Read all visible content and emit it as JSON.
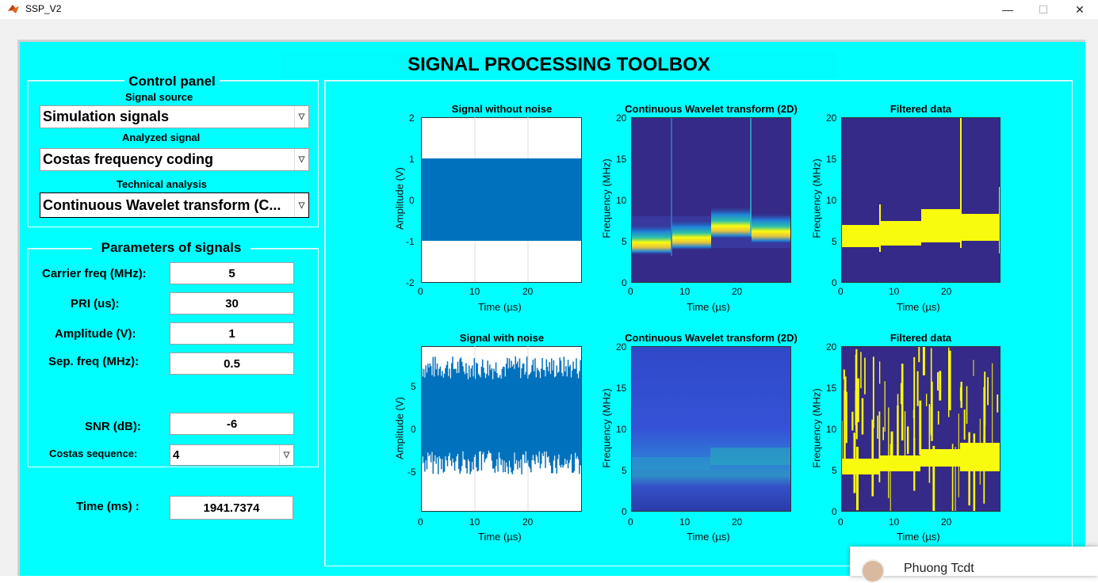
{
  "window": {
    "title": "SSP_V2",
    "min": "—",
    "max": "☐",
    "close": "✕"
  },
  "main_title": "SIGNAL PROCESSING TOOLBOX",
  "control_panel": {
    "title": "Control panel",
    "signal_source_label": "Signal source",
    "signal_source_value": "Simulation signals",
    "analyzed_label": "Analyzed signal",
    "analyzed_value": "Costas frequency coding",
    "technical_label": "Technical analysis",
    "technical_value": "Continuous Wavelet transform (C..."
  },
  "params": {
    "title": "Parameters of signals",
    "carrier_label": "Carrier freq (MHz):",
    "carrier_value": "5",
    "pri_label": "PRI (us):",
    "pri_value": "30",
    "amp_label": "Amplitude (V):",
    "amp_value": "1",
    "sep_label": "Sep.  freq (MHz):",
    "sep_value": "0.5",
    "snr_label": "SNR (dB):",
    "snr_value": "-6",
    "costas_label": "Costas sequence:",
    "costas_value": "4",
    "time_label": "Time (ms) :",
    "time_value": "1941.7374"
  },
  "plots": {
    "p1": {
      "title": "Signal without noise",
      "xlabel": "Time (µs)",
      "ylabel": "Amplitude (V)",
      "yticks": [
        "2",
        "1",
        "0",
        "-1",
        "-2"
      ],
      "xticks": [
        "0",
        "10",
        "20"
      ]
    },
    "p2": {
      "title": "Continuous Wavelet transform (2D)",
      "xlabel": "Time (µs)",
      "ylabel": "Frequency (MHz)",
      "yticks": [
        "20",
        "15",
        "10",
        "5",
        "0"
      ],
      "xticks": [
        "0",
        "10",
        "20"
      ]
    },
    "p3": {
      "title": "Filtered data",
      "xlabel": "Time (µs)",
      "ylabel": "Frequency (MHz)",
      "yticks": [
        "20",
        "15",
        "10",
        "5",
        "0"
      ],
      "xticks": [
        "0",
        "10",
        "20"
      ]
    },
    "p4": {
      "title": "Signal with noise",
      "xlabel": "Time (µs)",
      "ylabel": "Amplitude (V)",
      "yticks": [
        "5",
        "0",
        "-5"
      ],
      "xticks": [
        "0",
        "10",
        "20"
      ]
    },
    "p5": {
      "title": "Continuous Wavelet transform (2D)",
      "xlabel": "Time (µs)",
      "ylabel": "Frequency (MHz)",
      "yticks": [
        "20",
        "15",
        "10",
        "5",
        "0"
      ],
      "xticks": [
        "0",
        "10",
        "20"
      ]
    },
    "p6": {
      "title": "Filtered data",
      "xlabel": "Time (µs)",
      "ylabel": "Frequency (MHz)",
      "yticks": [
        "20",
        "15",
        "10",
        "5",
        "0"
      ],
      "xticks": [
        "0",
        "10",
        "20"
      ]
    }
  },
  "notification": {
    "name": "Phuong Tcdt"
  },
  "colors": {
    "figure_bg": "#00ffff",
    "signal_blue": "#0072bd",
    "parula_dark": "#352a87",
    "parula_yellow": "#f9fb0e"
  }
}
